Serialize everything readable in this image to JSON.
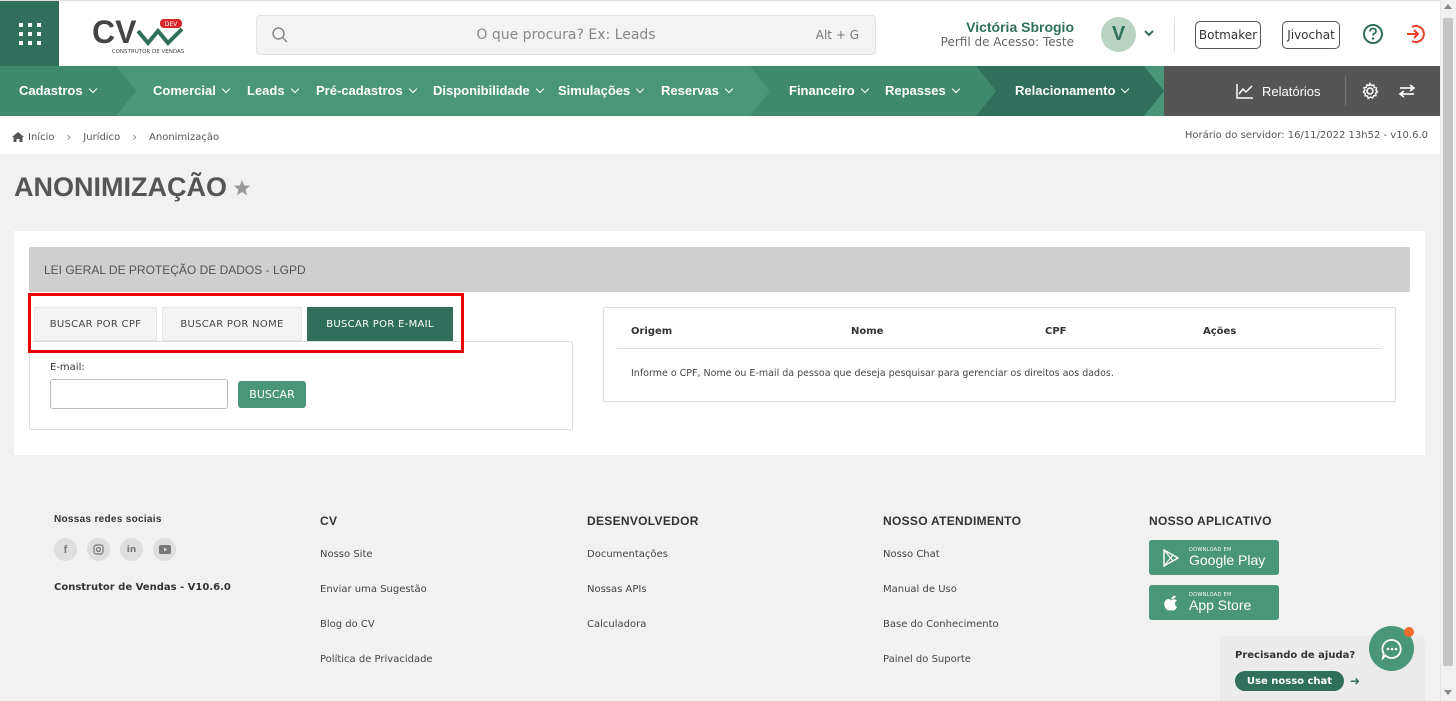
{
  "header": {
    "logo_text": "CV",
    "logo_badge": "DEV",
    "logo_subtitle": "CONSTRUTOR DE VENDAS",
    "search_placeholder": "O que procura? Ex: Leads",
    "search_hint": "Alt + G",
    "user_name": "Victória Sbrogio",
    "user_profile": "Perfil de Acesso: Teste",
    "avatar_initial": "V",
    "botmaker_label": "Botmaker",
    "jivochat_label": "Jivochat",
    "accent_color": "#2f6f5b",
    "exit_color": "#e8402a"
  },
  "nav": {
    "items": [
      {
        "label": "Cadastros"
      },
      {
        "label": "Comercial"
      },
      {
        "label": "Leads"
      },
      {
        "label": "Pré-cadastros"
      },
      {
        "label": "Disponibilidade"
      },
      {
        "label": "Simulações"
      },
      {
        "label": "Reservas"
      },
      {
        "label": "Financeiro"
      },
      {
        "label": "Repasses"
      },
      {
        "label": "Relacionamento"
      }
    ],
    "reports_label": "Relatórios",
    "bar_color": "#4a9678",
    "dark_color": "#2f6f5b"
  },
  "breadcrumb": {
    "items": [
      "Início",
      "Jurídico",
      "Anonimização"
    ],
    "server_time": "Horário do servidor: 16/11/2022 13h52 - v10.6.0"
  },
  "page": {
    "title": "ANONIMIZAÇÃO"
  },
  "card": {
    "header": "LEI GERAL DE PROTEÇÃO DE DADOS - LGPD",
    "tabs": [
      {
        "label": "BUSCAR POR CPF",
        "active": false
      },
      {
        "label": "BUSCAR POR NOME",
        "active": false
      },
      {
        "label": "BUSCAR POR E-MAIL",
        "active": true
      }
    ],
    "form": {
      "email_label": "E-mail:",
      "email_value": "",
      "search_button": "BUSCAR"
    },
    "results": {
      "columns": [
        "Origem",
        "Nome",
        "CPF",
        "Ações"
      ],
      "empty_message": "Informe o CPF, Nome ou E-mail da pessoa que deseja pesquisar para gerenciar os direitos aos dados."
    }
  },
  "footer": {
    "social_title": "Nossas redes sociais",
    "version": "Construtor de Vendas - V10.6.0",
    "cols": [
      {
        "title": "CV",
        "links": [
          "Nosso Site",
          "Enviar uma Sugestão",
          "Blog do CV",
          "Política de Privacidade"
        ]
      },
      {
        "title": "DESENVOLVEDOR",
        "links": [
          "Documentações",
          "Nossas APIs",
          "Calculadora"
        ]
      },
      {
        "title": "NOSSO ATENDIMENTO",
        "links": [
          "Nosso Chat",
          "Manual de Uso",
          "Base do Conhecimento",
          "Painel do Suporte"
        ]
      }
    ],
    "app_title": "NOSSO APLICATIVO",
    "google_play": {
      "small": "DOWNLOAD EM",
      "big": "Google Play"
    },
    "app_store": {
      "small": "DOWNLOAD EM",
      "big": "App Store"
    }
  },
  "help": {
    "question": "Precisando de ajuda?",
    "chat_button": "Use nosso chat"
  }
}
